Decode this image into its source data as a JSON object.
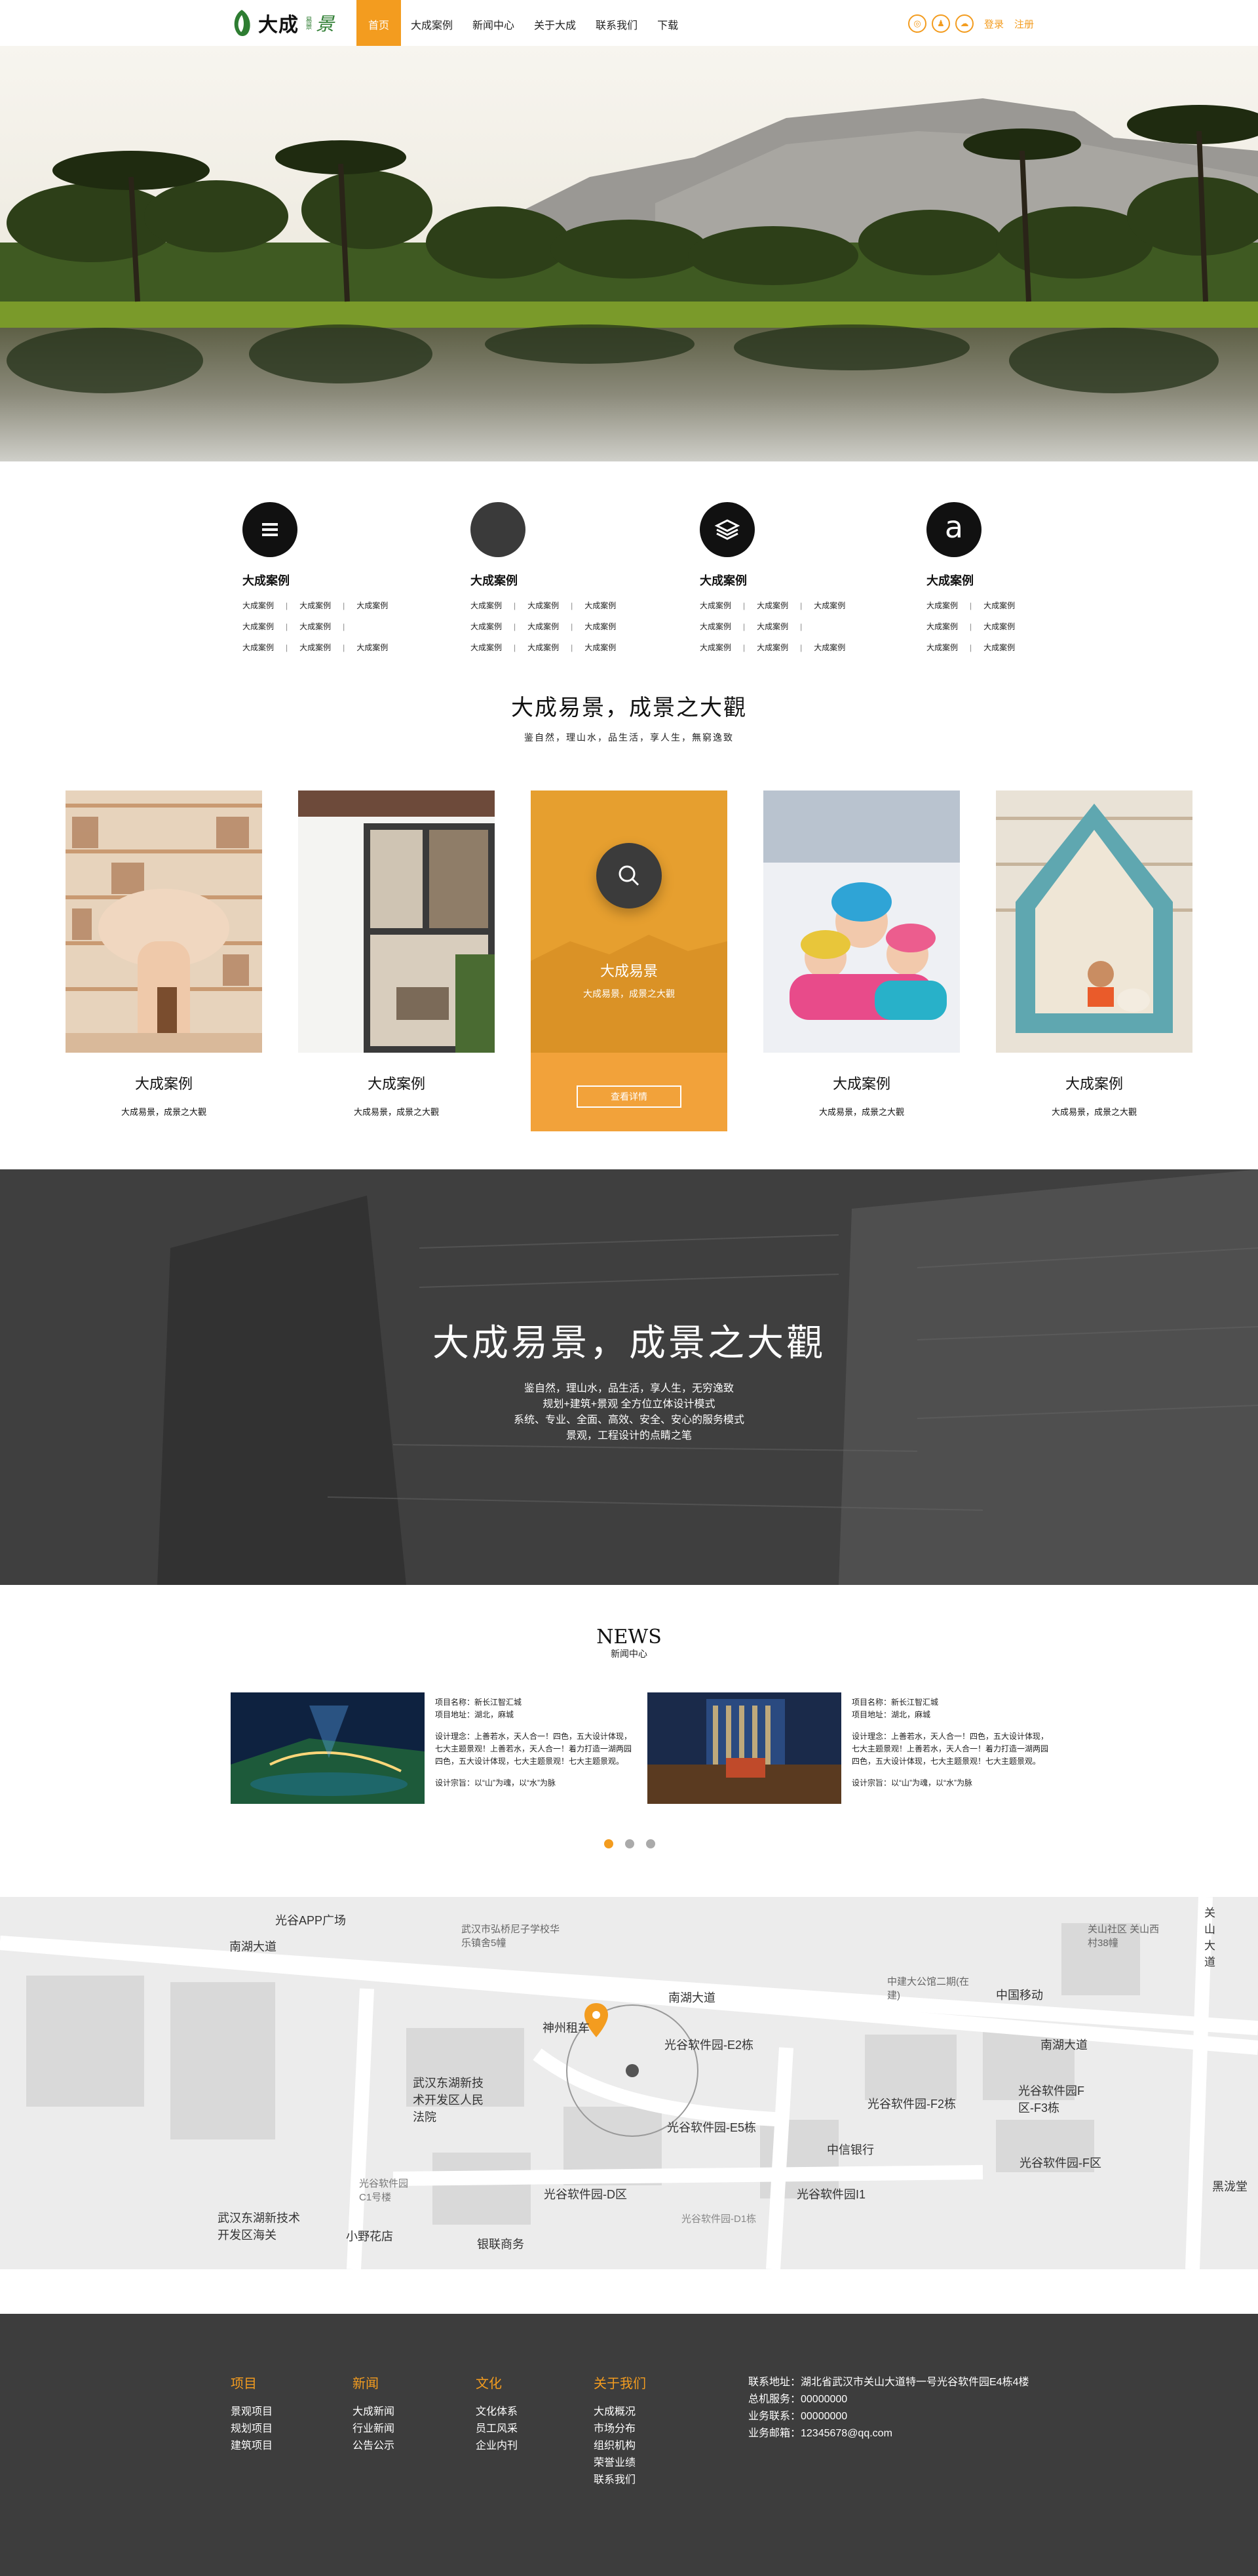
{
  "header": {
    "logo_text": "大成",
    "logo_mini": "易景",
    "logo_sub": "景",
    "nav": [
      "首页",
      "大成案例",
      "新闻中心",
      "关于大成",
      "联系我们",
      "下载"
    ],
    "login": "登录",
    "register": "注册",
    "accent": "#f39c1f"
  },
  "services": [
    {
      "icon": "list-icon",
      "title": "大成案例",
      "links": [
        "大成案例",
        "大成案例",
        "大成案例",
        "大成案例",
        "大成案例",
        "大成案例",
        "大成案例",
        "大成案例"
      ]
    },
    {
      "icon": "circle-icon",
      "title": "大成案例",
      "links": [
        "大成案例",
        "大成案例",
        "大成案例",
        "大成案例",
        "大成案例",
        "大成案例",
        "大成案例",
        "大成案例",
        "大成案例"
      ]
    },
    {
      "icon": "layers-icon",
      "title": "大成案例",
      "links": [
        "大成案例",
        "大成案例",
        "大成案例",
        "大成案例",
        "大成案例",
        "大成案例",
        "大成案例",
        "大成案例"
      ]
    },
    {
      "icon": "letter-a-icon",
      "title": "大成案例",
      "links": [
        "大成案例",
        "大成案例",
        "大成案例",
        "大成案例",
        "大成案例",
        "大成案例"
      ]
    }
  ],
  "slogan": {
    "title": "大成易景，成景之大觀",
    "sub": "鉴自然，理山水，品生活，享人生，無窮逸致"
  },
  "cards": [
    {
      "title": "大成案例",
      "sub": "大成易景，成景之大觀"
    },
    {
      "title": "大成案例",
      "sub": "大成易景，成景之大觀"
    },
    {
      "title": "大成易景",
      "sub": "大成易景，成景之大觀",
      "button": "查看详情"
    },
    {
      "title": "大成案例",
      "sub": "大成易景，成景之大觀"
    },
    {
      "title": "大成案例",
      "sub": "大成易景，成景之大觀"
    }
  ],
  "banner": {
    "title": "大成易景，成景之大觀",
    "lines": [
      "鉴自然，理山水，品生活，享人生，无穷逸致",
      "规划+建筑+景观 全方位立体设计模式",
      "系统、专业、全面、高效、安全、安心的服务模式",
      "景观，工程设计的点睛之笔"
    ]
  },
  "news": {
    "title": "NEWS",
    "subtitle": "新闻中心",
    "items": [
      {
        "name": "项目名称：新长江智汇城",
        "addr": "项目地址：湖北，麻城",
        "concept": "设计理念：上善若水，天人合一！四色，五大设计体现，七大主题景观！上善若水，天人合一！着力打造一湖两园四色，五大设计体现，七大主题景观！七大主题景观。",
        "aim": "设计宗旨：以“山”为魂，以“水”为脉"
      },
      {
        "name": "项目名称：新长江智汇城",
        "addr": "项目地址：湖北，麻城",
        "concept": "设计理念：上善若水，天人合一！四色，五大设计体现，七大主题景观！上善若水，天人合一！着力打造一湖两园四色，五大设计体现，七大主题景观！七大主题景观。",
        "aim": "设计宗旨：以“山”为魂，以“水”为脉"
      }
    ],
    "active_page": 1,
    "pages": 3
  },
  "map": {
    "labels": [
      "光谷APP广场",
      "南湖大道",
      "武汉市弘桥尼子学校华乐镇舍5幢",
      "中建大公馆二期(在建)",
      "中国移动",
      "关山社区 关山西村38幢",
      "关山大道",
      "南湖大道",
      "神州租车",
      "光谷软件园-E2栋",
      "南湖大道",
      "武汉东湖新技术开发区人民法院",
      "光谷软件园-F2栋",
      "光谷软件园F区-F3栋",
      "光谷软件园-E5栋",
      "中信银行",
      "光谷软件园-F区",
      "光谷软件园C1号楼",
      "光谷软件园-D区",
      "光谷软件园I1",
      "黑泷堂",
      "武汉东湖新技术开发区海关",
      "小野花店",
      "银联商务",
      "光谷软件园-D1栋"
    ]
  },
  "footer": {
    "cols": [
      {
        "title": "项目",
        "links": [
          "景观项目",
          "规划项目",
          "建筑项目"
        ]
      },
      {
        "title": "新闻",
        "links": [
          "大成新闻",
          "行业新闻",
          "公告公示"
        ]
      },
      {
        "title": "文化",
        "links": [
          "文化体系",
          "员工风采",
          "企业内刊"
        ]
      },
      {
        "title": "关于我们",
        "links": [
          "大成概况",
          "市场分布",
          "组织机构",
          "荣誉业绩",
          "联系我们"
        ]
      }
    ],
    "contact": [
      "联系地址：湖北省武汉市关山大道特一号光谷软件园E4栋4楼",
      "总机服务：00000000",
      "业务联系：00000000",
      "业务邮箱：12345678@qq.com"
    ]
  }
}
